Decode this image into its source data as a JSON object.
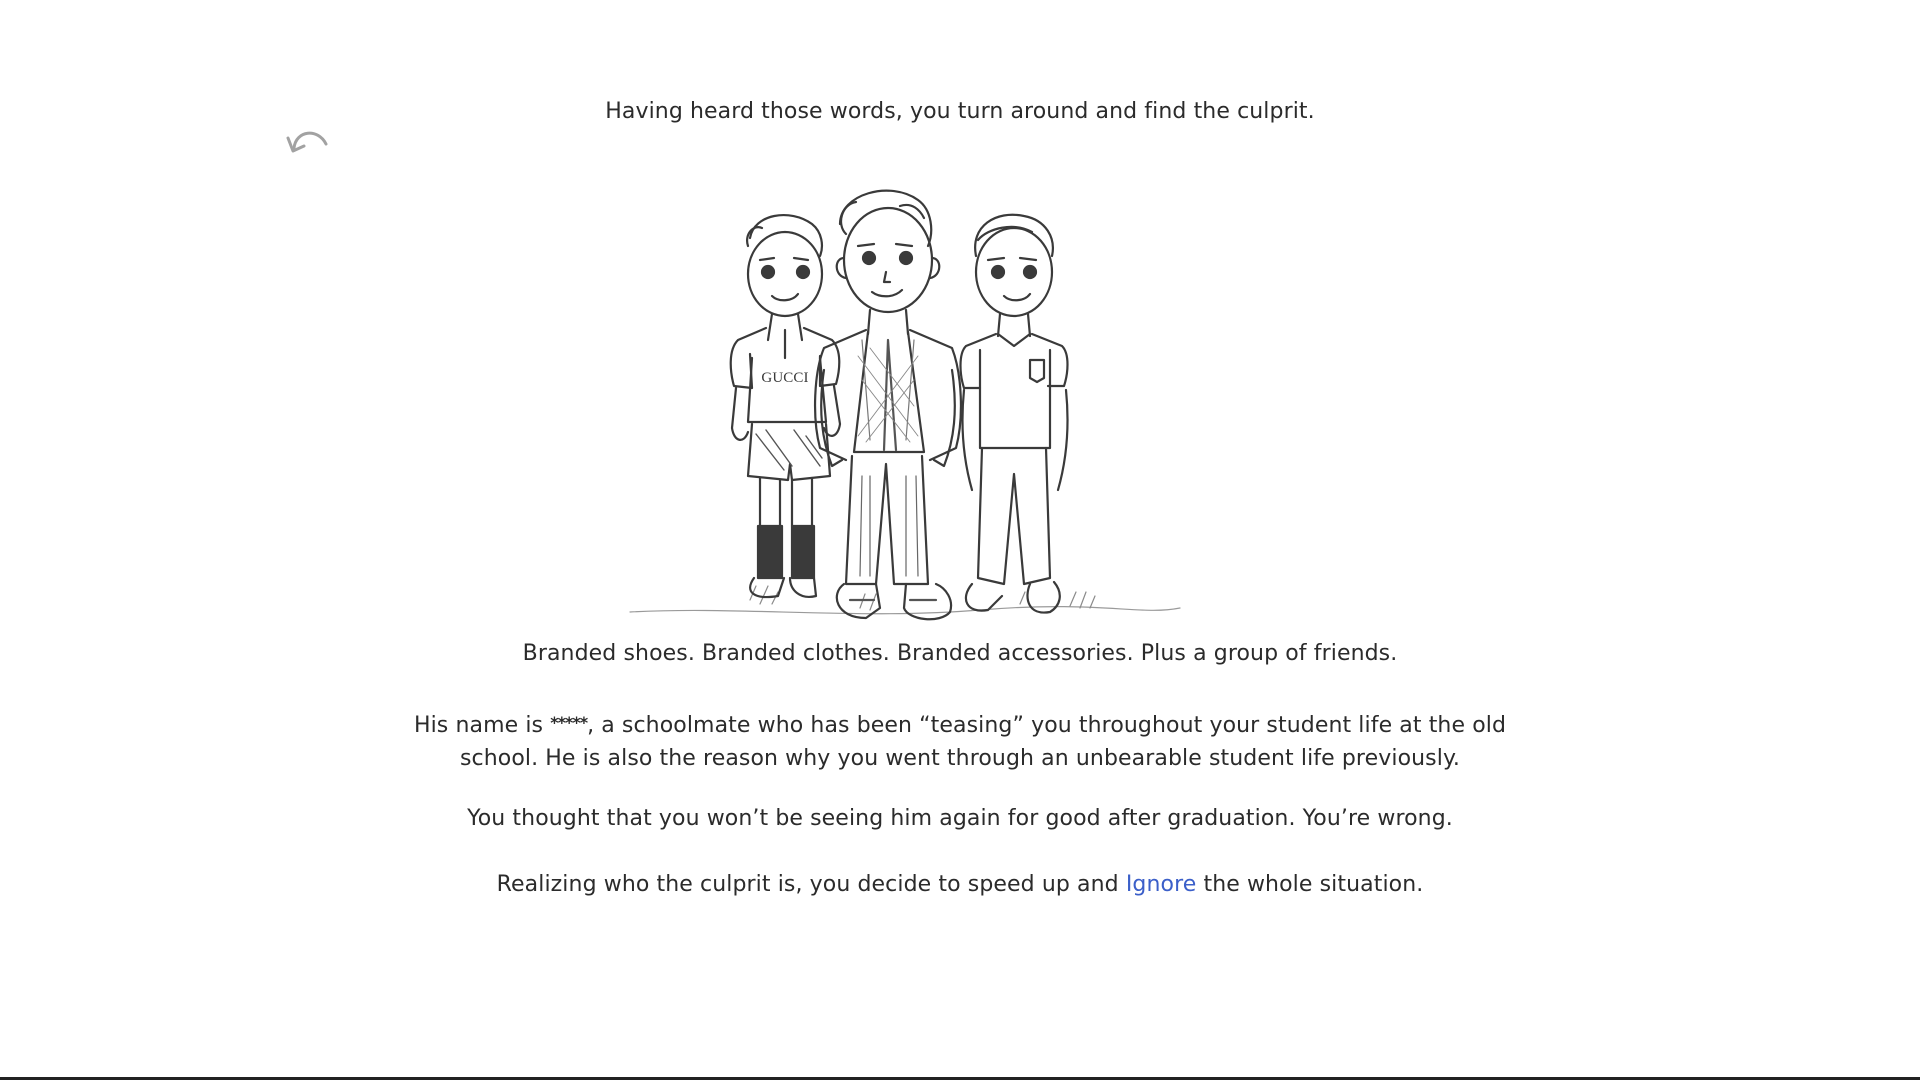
{
  "story": {
    "intro": "Having heard those words, you turn around and find the culprit.",
    "p1": "Branded shoes. Branded clothes. Branded accessories. Plus a group of friends.",
    "p2_before": "His name is ",
    "p2_masked": "*****",
    "p2_after": ", a schoolmate who has been “teasing” you throughout your student life at the old school. He is also the reason why you went through an unbearable student life previously.",
    "p3": "You thought that you won’t be seeing him again for good after graduation. You’re wrong.",
    "p4_before": "Realizing who the culprit is, you decide to speed up and ",
    "p4_link": "Ignore",
    "p4_after": " the whole situation."
  },
  "illustration": {
    "shirt_text": "GUCCI"
  },
  "colors": {
    "text": "#2b2b2b",
    "link": "#3b5fc9",
    "undo_icon": "#9a9a9a"
  },
  "icons": {
    "undo": "undo-arrow-icon"
  }
}
